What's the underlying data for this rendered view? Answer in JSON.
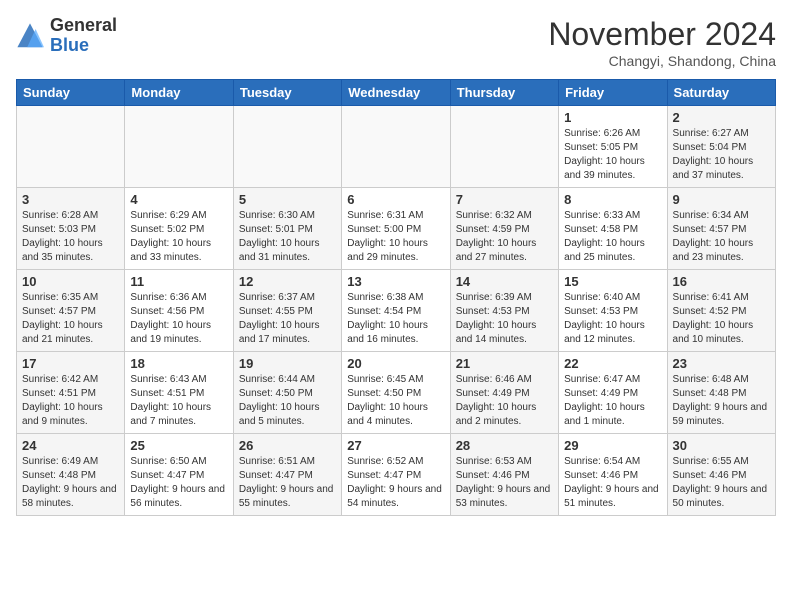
{
  "logo": {
    "general": "General",
    "blue": "Blue"
  },
  "title": "November 2024",
  "location": "Changyi, Shandong, China",
  "days_of_week": [
    "Sunday",
    "Monday",
    "Tuesday",
    "Wednesday",
    "Thursday",
    "Friday",
    "Saturday"
  ],
  "weeks": [
    [
      {
        "day": "",
        "info": ""
      },
      {
        "day": "",
        "info": ""
      },
      {
        "day": "",
        "info": ""
      },
      {
        "day": "",
        "info": ""
      },
      {
        "day": "",
        "info": ""
      },
      {
        "day": "1",
        "info": "Sunrise: 6:26 AM\nSunset: 5:05 PM\nDaylight: 10 hours and 39 minutes."
      },
      {
        "day": "2",
        "info": "Sunrise: 6:27 AM\nSunset: 5:04 PM\nDaylight: 10 hours and 37 minutes."
      }
    ],
    [
      {
        "day": "3",
        "info": "Sunrise: 6:28 AM\nSunset: 5:03 PM\nDaylight: 10 hours and 35 minutes."
      },
      {
        "day": "4",
        "info": "Sunrise: 6:29 AM\nSunset: 5:02 PM\nDaylight: 10 hours and 33 minutes."
      },
      {
        "day": "5",
        "info": "Sunrise: 6:30 AM\nSunset: 5:01 PM\nDaylight: 10 hours and 31 minutes."
      },
      {
        "day": "6",
        "info": "Sunrise: 6:31 AM\nSunset: 5:00 PM\nDaylight: 10 hours and 29 minutes."
      },
      {
        "day": "7",
        "info": "Sunrise: 6:32 AM\nSunset: 4:59 PM\nDaylight: 10 hours and 27 minutes."
      },
      {
        "day": "8",
        "info": "Sunrise: 6:33 AM\nSunset: 4:58 PM\nDaylight: 10 hours and 25 minutes."
      },
      {
        "day": "9",
        "info": "Sunrise: 6:34 AM\nSunset: 4:57 PM\nDaylight: 10 hours and 23 minutes."
      }
    ],
    [
      {
        "day": "10",
        "info": "Sunrise: 6:35 AM\nSunset: 4:57 PM\nDaylight: 10 hours and 21 minutes."
      },
      {
        "day": "11",
        "info": "Sunrise: 6:36 AM\nSunset: 4:56 PM\nDaylight: 10 hours and 19 minutes."
      },
      {
        "day": "12",
        "info": "Sunrise: 6:37 AM\nSunset: 4:55 PM\nDaylight: 10 hours and 17 minutes."
      },
      {
        "day": "13",
        "info": "Sunrise: 6:38 AM\nSunset: 4:54 PM\nDaylight: 10 hours and 16 minutes."
      },
      {
        "day": "14",
        "info": "Sunrise: 6:39 AM\nSunset: 4:53 PM\nDaylight: 10 hours and 14 minutes."
      },
      {
        "day": "15",
        "info": "Sunrise: 6:40 AM\nSunset: 4:53 PM\nDaylight: 10 hours and 12 minutes."
      },
      {
        "day": "16",
        "info": "Sunrise: 6:41 AM\nSunset: 4:52 PM\nDaylight: 10 hours and 10 minutes."
      }
    ],
    [
      {
        "day": "17",
        "info": "Sunrise: 6:42 AM\nSunset: 4:51 PM\nDaylight: 10 hours and 9 minutes."
      },
      {
        "day": "18",
        "info": "Sunrise: 6:43 AM\nSunset: 4:51 PM\nDaylight: 10 hours and 7 minutes."
      },
      {
        "day": "19",
        "info": "Sunrise: 6:44 AM\nSunset: 4:50 PM\nDaylight: 10 hours and 5 minutes."
      },
      {
        "day": "20",
        "info": "Sunrise: 6:45 AM\nSunset: 4:50 PM\nDaylight: 10 hours and 4 minutes."
      },
      {
        "day": "21",
        "info": "Sunrise: 6:46 AM\nSunset: 4:49 PM\nDaylight: 10 hours and 2 minutes."
      },
      {
        "day": "22",
        "info": "Sunrise: 6:47 AM\nSunset: 4:49 PM\nDaylight: 10 hours and 1 minute."
      },
      {
        "day": "23",
        "info": "Sunrise: 6:48 AM\nSunset: 4:48 PM\nDaylight: 9 hours and 59 minutes."
      }
    ],
    [
      {
        "day": "24",
        "info": "Sunrise: 6:49 AM\nSunset: 4:48 PM\nDaylight: 9 hours and 58 minutes."
      },
      {
        "day": "25",
        "info": "Sunrise: 6:50 AM\nSunset: 4:47 PM\nDaylight: 9 hours and 56 minutes."
      },
      {
        "day": "26",
        "info": "Sunrise: 6:51 AM\nSunset: 4:47 PM\nDaylight: 9 hours and 55 minutes."
      },
      {
        "day": "27",
        "info": "Sunrise: 6:52 AM\nSunset: 4:47 PM\nDaylight: 9 hours and 54 minutes."
      },
      {
        "day": "28",
        "info": "Sunrise: 6:53 AM\nSunset: 4:46 PM\nDaylight: 9 hours and 53 minutes."
      },
      {
        "day": "29",
        "info": "Sunrise: 6:54 AM\nSunset: 4:46 PM\nDaylight: 9 hours and 51 minutes."
      },
      {
        "day": "30",
        "info": "Sunrise: 6:55 AM\nSunset: 4:46 PM\nDaylight: 9 hours and 50 minutes."
      }
    ]
  ]
}
